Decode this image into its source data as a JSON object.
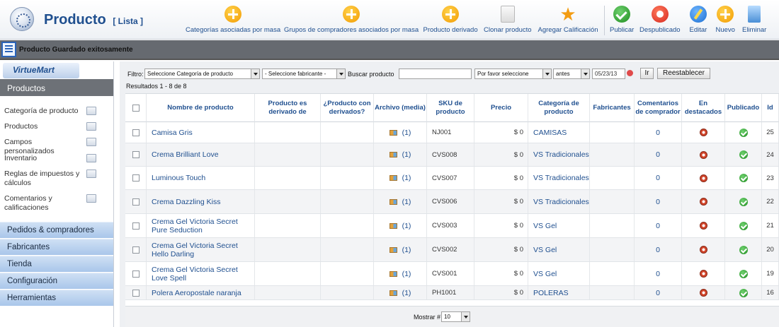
{
  "header": {
    "title": "Producto",
    "subtitle": "[ Lista ]"
  },
  "toolbar": [
    {
      "label": "Categorías asociadas por masa",
      "icon": "plus-icon"
    },
    {
      "label": "Grupos de compradores asociados por masa",
      "icon": "plus-icon"
    },
    {
      "label": "Producto derivado",
      "icon": "plus-icon"
    },
    {
      "label": "Clonar producto",
      "icon": "clone-icon"
    },
    {
      "label": "Agregar Calificación",
      "icon": "star-icon"
    },
    {
      "label": "Publicar",
      "icon": "check-icon"
    },
    {
      "label": "Despublicado",
      "icon": "unpublish-icon"
    },
    {
      "label": "Editar",
      "icon": "edit-icon"
    },
    {
      "label": "Nuevo",
      "icon": "plus-icon"
    },
    {
      "label": "Eliminar",
      "icon": "trash-icon"
    }
  ],
  "message": "Producto Guardado exitosamente",
  "sidebar": {
    "logo": "VirtueMart",
    "active_section": "Productos",
    "items": [
      {
        "label": "Categoría de producto",
        "icon": "folder-icon"
      },
      {
        "label": "Productos",
        "icon": "camera-icon"
      },
      {
        "label": "Campos personalizados",
        "icon": "document-icon"
      },
      {
        "label": "Inventario",
        "icon": "chart-icon"
      },
      {
        "label": "Reglas de impuestos y cálculos",
        "icon": "calculator-icon"
      },
      {
        "label": "Comentarios y calificaciones",
        "icon": "comment-icon"
      }
    ],
    "sections": [
      "Pedidos & compradores",
      "Fabricantes",
      "Tienda",
      "Configuración",
      "Herramientas"
    ]
  },
  "filters": {
    "label": "Filtro:",
    "category_select": "Seleccione Categoría de producto",
    "manufacturer_select": "- Seleccione fabricante -",
    "search_label": "Buscar producto",
    "search_value": "",
    "order_select": "Por favor seleccione",
    "when_select": "antes",
    "date_value": "05/23/13",
    "go_button": "Ir",
    "reset_button": "Reestablecer",
    "results": "Resultados 1 - 8 de 8"
  },
  "table": {
    "headers": [
      "Nombre de producto",
      "Producto es derivado de",
      "¿Producto con derivados?",
      "Archivo (media)",
      "SKU de producto",
      "Precio",
      "Categoría de producto",
      "Fabricantes",
      "Comentarios de comprador",
      "En destacados",
      "Publicado",
      "Id"
    ],
    "rows": [
      {
        "name": "Camisa Gris",
        "media": "(1)",
        "sku": "NJ001",
        "price": "$ 0",
        "category": "CAMISAS",
        "reviews": "0",
        "id": "25"
      },
      {
        "name": "Crema Brilliant Love",
        "media": "(1)",
        "sku": "CVS008",
        "price": "$ 0",
        "category": "VS Tradicionales",
        "reviews": "0",
        "id": "24"
      },
      {
        "name": "Luminous Touch",
        "media": "(1)",
        "sku": "CVS007",
        "price": "$ 0",
        "category": "VS Tradicionales",
        "reviews": "0",
        "id": "23"
      },
      {
        "name": "Crema Dazzling Kiss",
        "media": "(1)",
        "sku": "CVS006",
        "price": "$ 0",
        "category": "VS Tradicionales",
        "reviews": "0",
        "id": "22"
      },
      {
        "name": "Crema Gel Victoria Secret Pure Seduction",
        "media": "(1)",
        "sku": "CVS003",
        "price": "$ 0",
        "category": "VS Gel",
        "reviews": "0",
        "id": "21"
      },
      {
        "name": "Crema Gel Victoria Secret Hello Darling",
        "media": "(1)",
        "sku": "CVS002",
        "price": "$ 0",
        "category": "VS Gel",
        "reviews": "0",
        "id": "20"
      },
      {
        "name": "Crema Gel Victoria Secret Love Spell",
        "media": "(1)",
        "sku": "CVS001",
        "price": "$ 0",
        "category": "VS Gel",
        "reviews": "0",
        "id": "19"
      },
      {
        "name": "Polera Aeropostale naranja",
        "media": "(1)",
        "sku": "PH1001",
        "price": "$ 0",
        "category": "POLERAS",
        "reviews": "0",
        "id": "16"
      }
    ]
  },
  "footer": {
    "show_label": "Mostrar #",
    "show_value": "10"
  }
}
